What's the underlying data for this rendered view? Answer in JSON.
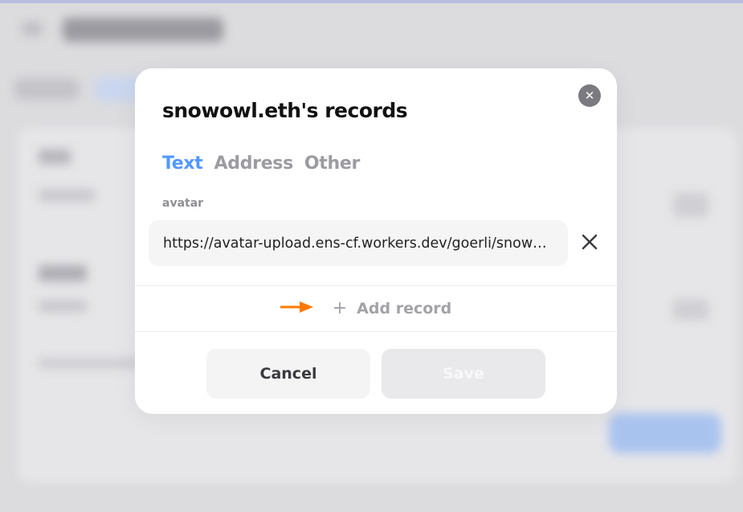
{
  "modal": {
    "title": "snowowl.eth's records",
    "close_icon": "close-icon",
    "tabs": [
      {
        "label": "Text",
        "active": true
      },
      {
        "label": "Address",
        "active": false
      },
      {
        "label": "Other",
        "active": false
      }
    ],
    "record": {
      "key_label": "avatar",
      "value": "https://avatar-upload.ens-cf.workers.dev/goerli/snowowl.eth",
      "remove_icon": "x-icon"
    },
    "add_record": {
      "icon": "plus-icon",
      "label": "Add record"
    },
    "buttons": {
      "cancel": "Cancel",
      "save": "Save"
    }
  },
  "colors": {
    "accent": "#5298ff",
    "annotation_arrow": "#ff7a00",
    "title": "#111111",
    "muted": "#9b9ba1"
  }
}
